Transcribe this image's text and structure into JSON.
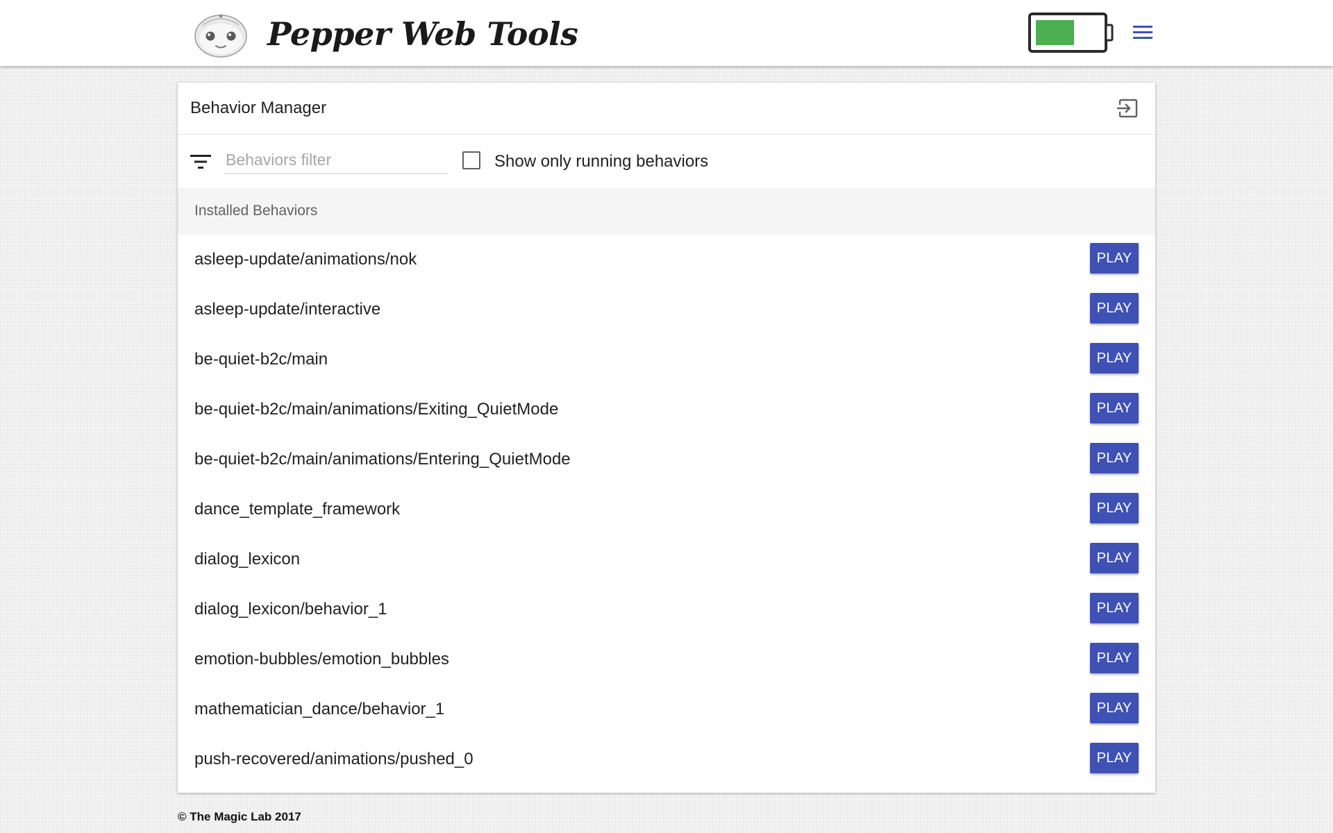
{
  "header": {
    "brand_title": "Pepper Web Tools",
    "logo_icon": "pepper-robot-face-icon",
    "battery_icon": "battery-icon",
    "battery_level": 0.6,
    "battery_fill_color": "#4caf50",
    "menu_icon": "hamburger-menu-icon"
  },
  "panel": {
    "title": "Behavior Manager",
    "exit_icon": "exit-to-app-icon",
    "filter_icon": "filter-list-icon",
    "filter_placeholder": "Behaviors filter",
    "filter_value": "",
    "running_only_label": "Show only running behaviors",
    "running_only_checked": false,
    "section_label": "Installed Behaviors",
    "behaviors": [
      {
        "name": "asleep-update/animations/nok",
        "action": "PLAY"
      },
      {
        "name": "asleep-update/interactive",
        "action": "PLAY"
      },
      {
        "name": "be-quiet-b2c/main",
        "action": "PLAY"
      },
      {
        "name": "be-quiet-b2c/main/animations/Exiting_QuietMode",
        "action": "PLAY"
      },
      {
        "name": "be-quiet-b2c/main/animations/Entering_QuietMode",
        "action": "PLAY"
      },
      {
        "name": "dance_template_framework",
        "action": "PLAY"
      },
      {
        "name": "dialog_lexicon",
        "action": "PLAY"
      },
      {
        "name": "dialog_lexicon/behavior_1",
        "action": "PLAY"
      },
      {
        "name": "emotion-bubbles/emotion_bubbles",
        "action": "PLAY"
      },
      {
        "name": "mathematician_dance/behavior_1",
        "action": "PLAY"
      },
      {
        "name": "push-recovered/animations/pushed_0",
        "action": "PLAY"
      }
    ]
  },
  "footer": {
    "text": "© The Magic Lab 2017"
  },
  "colors": {
    "accent": "#3f51b5",
    "battery_green": "#4caf50"
  }
}
